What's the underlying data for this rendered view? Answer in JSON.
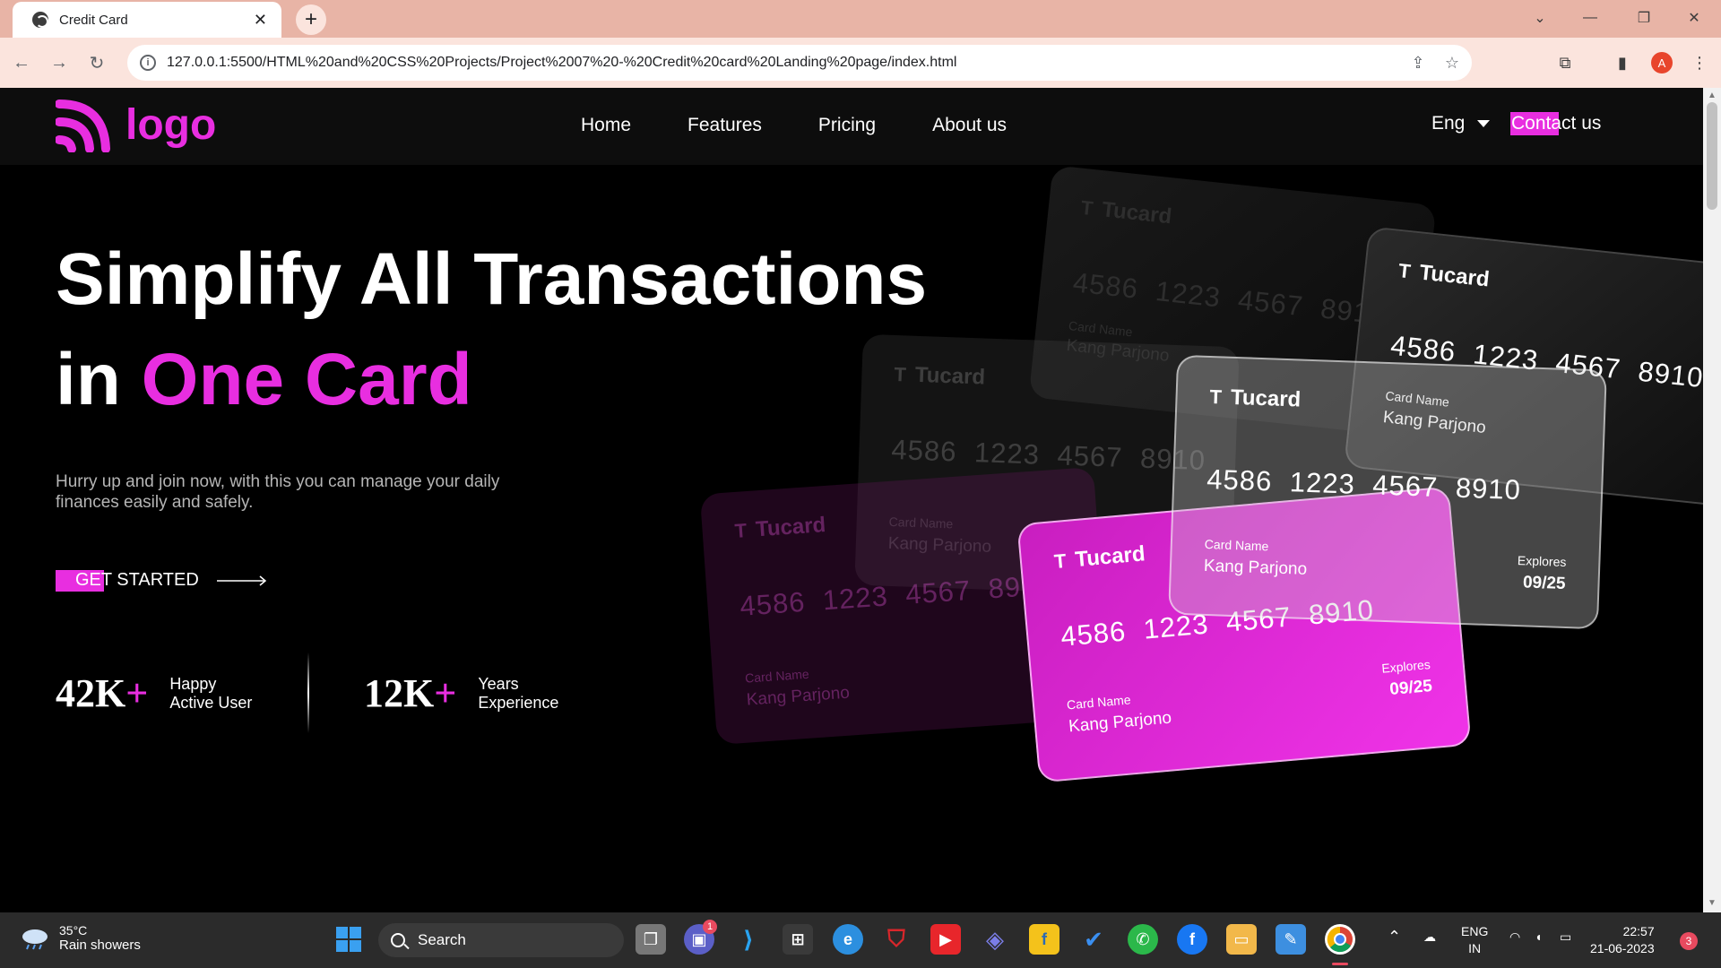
{
  "browser": {
    "tab_title": "Credit Card",
    "tab_close": "✕",
    "new_tab": "+",
    "url": "127.0.0.1:5500/HTML%20and%20CSS%20Projects/Project%2007%20-%20Credit%20card%20Landing%20page/index.html",
    "profile_initial": "A"
  },
  "nav": {
    "logo_text": "logo",
    "menu": [
      "Home",
      "Features",
      "Pricing",
      "About us"
    ],
    "language": "Eng",
    "contact": "Contact us"
  },
  "hero": {
    "title_line1": "Simplify All Transactions",
    "title_line2_prefix": "in ",
    "title_line2_accent": "One Card",
    "subtitle": "Hurry up and join now, with this you can manage your daily finances easily and safely.",
    "cta": "GET STARTED"
  },
  "stats": [
    {
      "number": "42K",
      "plus": "+",
      "label_line1": "Happy",
      "label_line2": "Active User"
    },
    {
      "number": "12K",
      "plus": "+",
      "label_line1": "Years",
      "label_line2": "Experience"
    }
  ],
  "card": {
    "brand": "Tucard",
    "brand_mark": "T",
    "number": "4586 1223 4567 8910",
    "name_label": "Card Name",
    "name": "Kang Parjono",
    "expiry_label": "Explores",
    "expiry": "09/25"
  },
  "taskbar": {
    "weather_temp": "35°C",
    "weather_desc": "Rain showers",
    "search_label": "Search",
    "lang_line1": "ENG",
    "lang_line2": "IN",
    "time": "22:57",
    "date": "21-06-2023",
    "notifications": "3",
    "teams_badge": "1"
  },
  "colors": {
    "accent": "#e82ee0",
    "nav_bg": "#0d0d0d",
    "page_bg": "#000000"
  }
}
